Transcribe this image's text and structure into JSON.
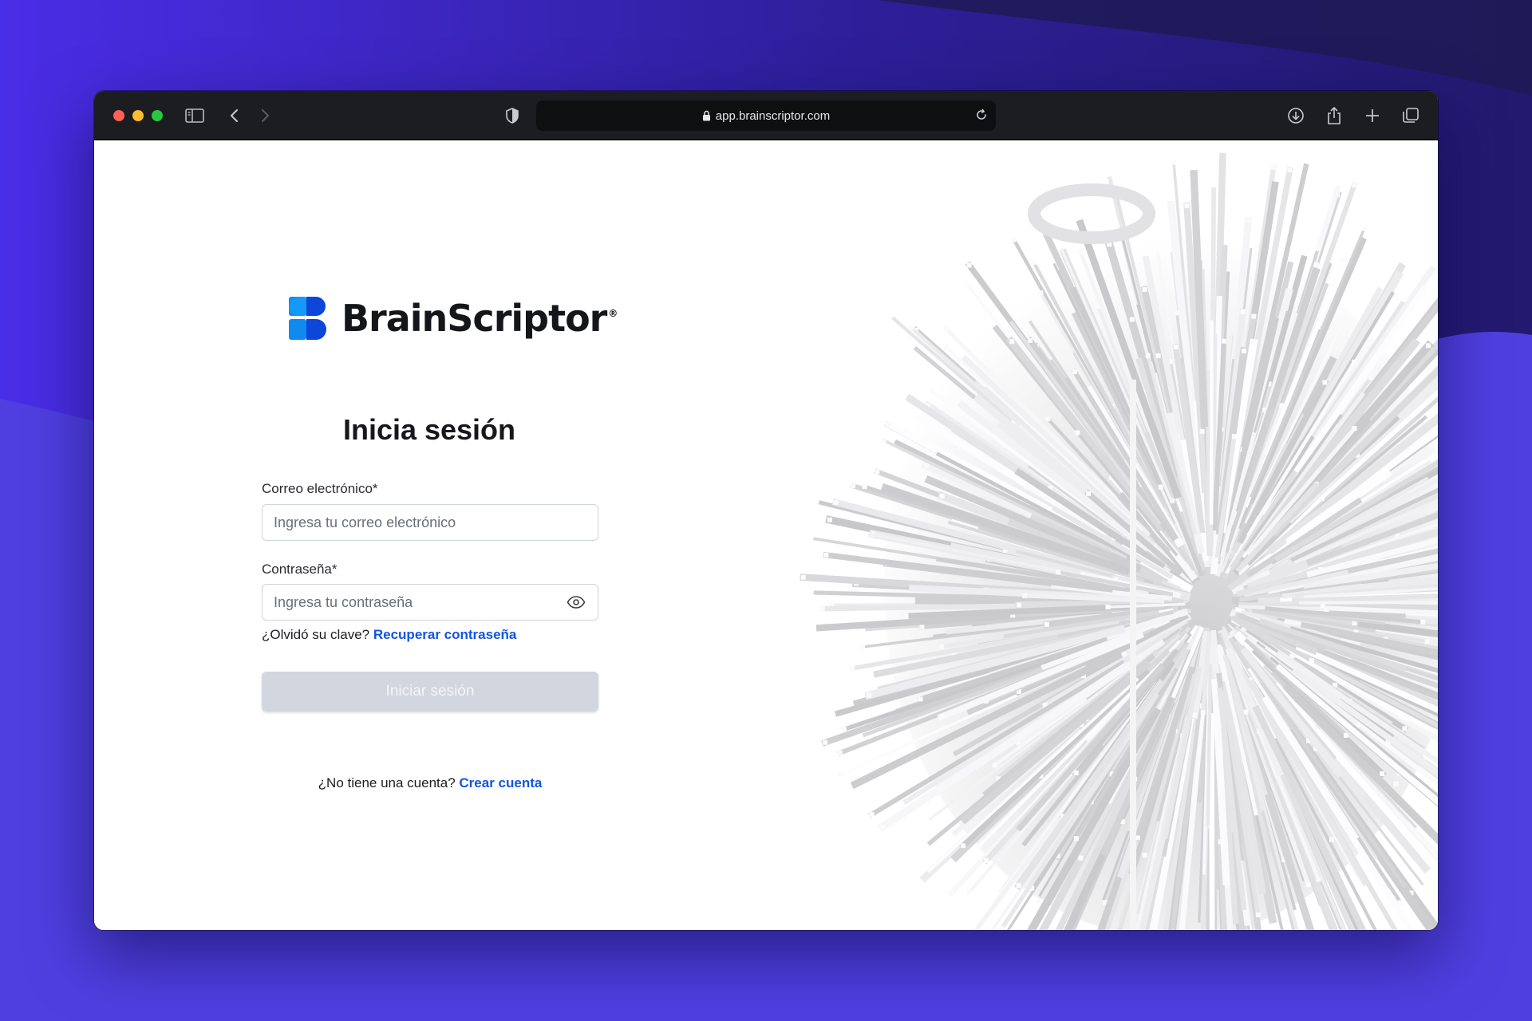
{
  "browser": {
    "url": "app.brainscriptor.com"
  },
  "brand": {
    "name": "BrainScriptor",
    "registered": "®",
    "colors": {
      "primary": "#0f8bf0",
      "dark": "#0d47d9"
    }
  },
  "login": {
    "title": "Inicia sesión",
    "email_label": "Correo electrónico*",
    "email_placeholder": "Ingresa tu correo electrónico",
    "password_label": "Contraseña*",
    "password_placeholder": "Ingresa tu contraseña",
    "forgot_prompt": "¿Olvidó su clave?",
    "forgot_link": "Recuperar contraseña",
    "submit_label": "Iniciar sesión",
    "signup_prompt": "¿No tiene una cuenta?",
    "signup_link": "Crear cuenta"
  },
  "icons": {
    "sidebar": "sidebar-icon",
    "back": "chevron-left-icon",
    "forward": "chevron-right-icon",
    "shield": "shield-icon",
    "lock": "lock-icon",
    "reload": "reload-icon",
    "download": "download-icon",
    "share": "share-icon",
    "new_tab": "plus-icon",
    "tabs": "tabs-overview-icon",
    "eye": "eye-icon"
  }
}
